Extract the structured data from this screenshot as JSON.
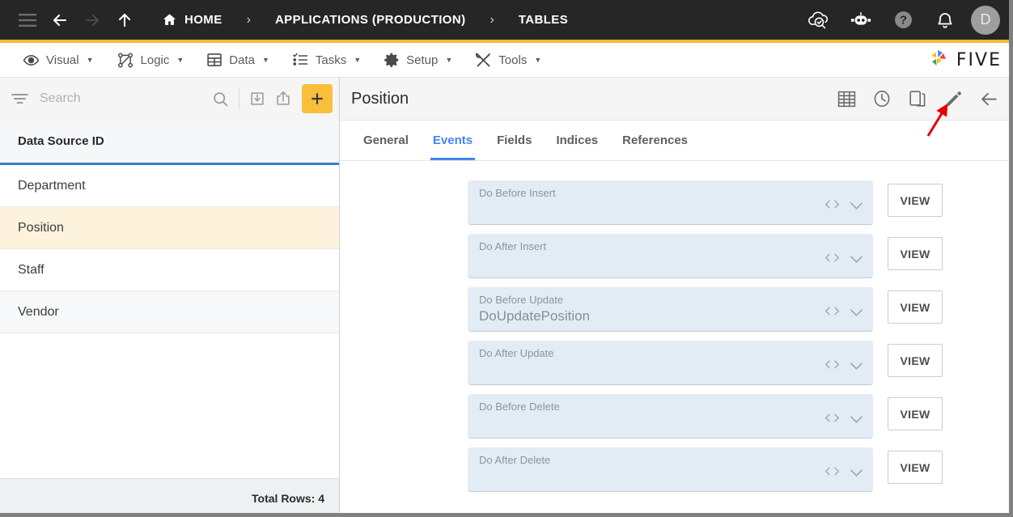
{
  "topbar": {
    "icons": [
      "menu-icon",
      "back-arrow-icon",
      "forward-arrow-icon",
      "up-arrow-icon"
    ],
    "breadcrumbs": [
      {
        "label": "HOME",
        "icon": "home-icon"
      },
      {
        "label": "APPLICATIONS (PRODUCTION)",
        "icon": ""
      },
      {
        "label": "TABLES",
        "icon": ""
      }
    ],
    "separator": "›",
    "right_icons": [
      "cloud-check-icon",
      "chatbot-icon",
      "help-icon",
      "bell-icon"
    ],
    "avatar_initial": "D"
  },
  "menubar": {
    "items": [
      {
        "label": "Visual",
        "icon": "eye-icon"
      },
      {
        "label": "Logic",
        "icon": "logic-flow-icon"
      },
      {
        "label": "Data",
        "icon": "table-grid-icon"
      },
      {
        "label": "Tasks",
        "icon": "checklist-icon"
      },
      {
        "label": "Setup",
        "icon": "gear-icon"
      },
      {
        "label": "Tools",
        "icon": "tools-icon"
      }
    ],
    "caret": "▼",
    "brand": "FIVE"
  },
  "sidebar": {
    "search": {
      "placeholder": "Search",
      "value": ""
    },
    "toolbar_icons": [
      "filter-icon",
      "search-icon",
      "import-icon",
      "export-icon",
      "add-icon"
    ],
    "add_label": "+",
    "column_header": "Data Source ID",
    "rows": [
      {
        "label": "Department",
        "selected": false
      },
      {
        "label": "Position",
        "selected": true
      },
      {
        "label": "Staff",
        "selected": false
      },
      {
        "label": "Vendor",
        "selected": false
      }
    ],
    "footer": "Total Rows: 4"
  },
  "main": {
    "title": "Position",
    "action_icons": [
      "table-view-icon",
      "history-icon",
      "duplicate-icon",
      "edit-pencil-icon",
      "back-arrow-icon"
    ],
    "tabs": [
      {
        "label": "General",
        "active": false
      },
      {
        "label": "Events",
        "active": true
      },
      {
        "label": "Fields",
        "active": false
      },
      {
        "label": "Indices",
        "active": false
      },
      {
        "label": "References",
        "active": false
      }
    ],
    "view_label": "VIEW",
    "events": [
      {
        "label": "Do Before Insert",
        "value": ""
      },
      {
        "label": "Do After Insert",
        "value": ""
      },
      {
        "label": "Do Before Update",
        "value": "DoUpdatePosition"
      },
      {
        "label": "Do After Update",
        "value": ""
      },
      {
        "label": "Do Before Delete",
        "value": ""
      },
      {
        "label": "Do After Delete",
        "value": ""
      }
    ]
  },
  "annotation": {
    "type": "red-arrow",
    "points_to": "edit-pencil-icon"
  },
  "colors": {
    "topbar_bg": "#262626",
    "accent_yellow": "#f5b731",
    "tab_active_blue": "#4285f4",
    "header_underline_blue": "#3d7fc1",
    "selected_row": "#fdf3dd",
    "field_bg": "#e3ecf5",
    "annotation_red": "#e60000"
  }
}
